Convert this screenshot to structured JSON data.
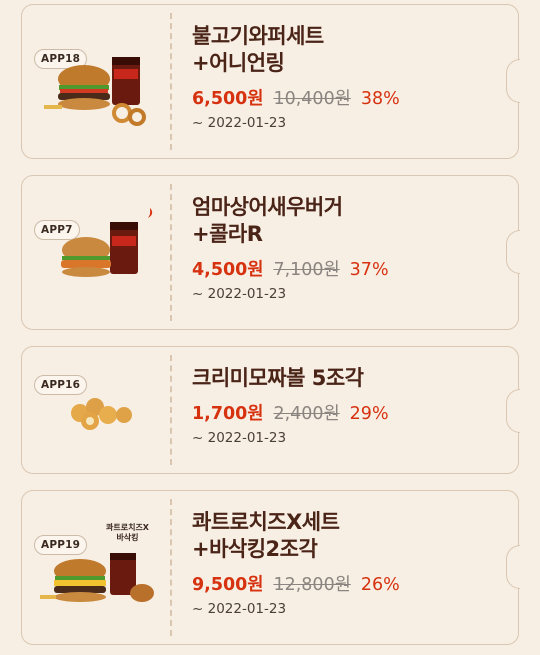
{
  "coupons": [
    {
      "badge": "APP18",
      "name": "불고기와퍼세트\n+어니언링",
      "sale_price": "6,500원",
      "original_price": "10,400원",
      "discount": "38%",
      "expire": "~ 2022-01-23"
    },
    {
      "badge": "APP7",
      "name": "엄마상어새우버거\n+콜라R",
      "sale_price": "4,500원",
      "original_price": "7,100원",
      "discount": "37%",
      "expire": "~ 2022-01-23"
    },
    {
      "badge": "APP16",
      "name": "크리미모짜볼 5조각",
      "sale_price": "1,700원",
      "original_price": "2,400원",
      "discount": "29%",
      "expire": "~ 2022-01-23"
    },
    {
      "badge": "APP19",
      "name": "콰트로치즈X세트\n+바삭킹2조각",
      "sale_price": "9,500원",
      "original_price": "12,800원",
      "discount": "26%",
      "expire": "~ 2022-01-23",
      "product_tag": "콰트로치즈X\n바삭킹"
    }
  ],
  "colors": {
    "background": "#f8efe4",
    "price_accent": "#d6320f",
    "name": "#4b2418"
  }
}
